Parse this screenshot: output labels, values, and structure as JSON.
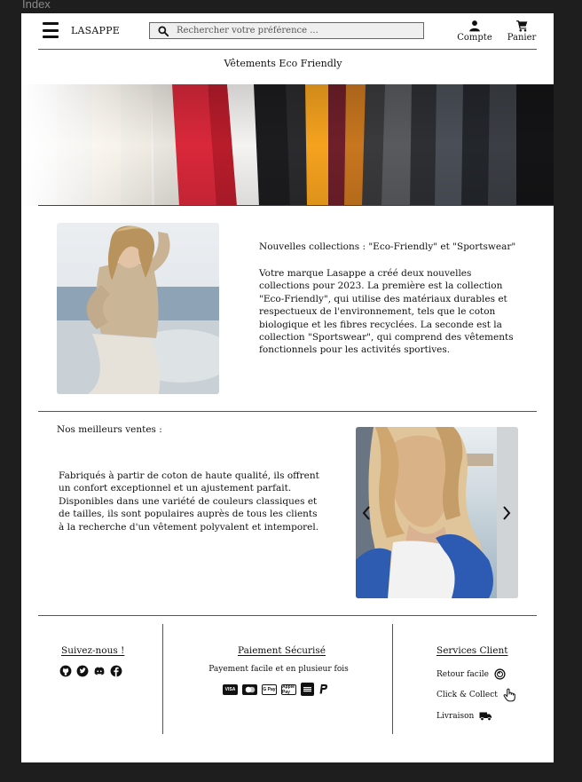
{
  "frame": {
    "label": "Index"
  },
  "header": {
    "brand": "LASAPPE",
    "search_placeholder": "Rechercher votre préférence ...",
    "account_label": "Compte",
    "cart_label": "Panier"
  },
  "tagline": "Vêtements Eco Friendly",
  "collections": {
    "title": "Nouvelles collections : \"Eco-Friendly\" et \"Sportswear\"",
    "text": "Votre marque Lasappe a créé deux nouvelles collections pour 2023. La première est la collection \"Eco-Friendly\", qui utilise des matériaux durables et respectueux de l'environnement, tels que le coton biologique et les fibres recyclées. La seconde est la collection \"Sportswear\", qui comprend des vêtements fonctionnels pour les activités sportives."
  },
  "bestsellers": {
    "title": "Nos meilleurs ventes :",
    "text": "Fabriqués à partir de coton de haute qualité, ils offrent un confort exceptionnel et un ajustement parfait. Disponibles dans une variété de couleurs classiques et de tailles, ils sont populaires auprès de tous les clients à la recherche d'un vêtement polyvalent et intemporel."
  },
  "footer": {
    "follow_title": "Suivez-nous !",
    "social_icons": [
      "github-icon",
      "twitter-icon",
      "discord-icon",
      "facebook-icon"
    ],
    "payment_title": "Paiement Sécurisé",
    "payment_subtitle": "Payement facile et en plusieur fois",
    "payment_methods": [
      "VISA",
      "Mastercard",
      "G Pay",
      "Apple Pay",
      "American Express",
      "PayPal"
    ],
    "services_title": "Services Client",
    "services": [
      {
        "label": "Retour facile",
        "icon": "return-icon"
      },
      {
        "label": "Click & Collect",
        "icon": "hand-pointer-icon"
      },
      {
        "label": "Livraison",
        "icon": "truck-icon"
      }
    ]
  }
}
